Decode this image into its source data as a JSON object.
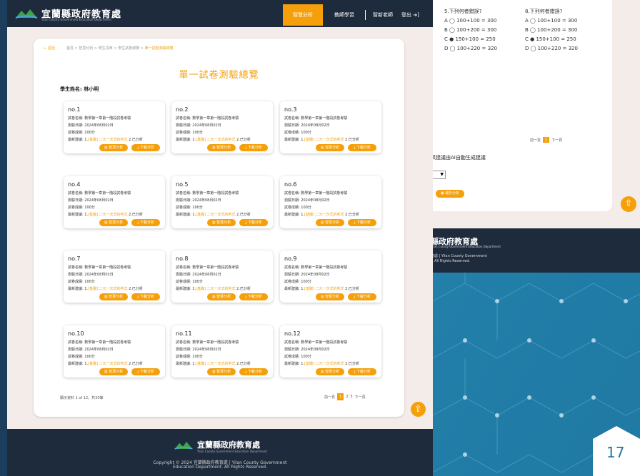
{
  "app": {
    "title": "宜蘭縣政府教育處",
    "subtitle": "Yilan County Government Education Department"
  },
  "nav": {
    "active": "智慧分析",
    "items": [
      "教師學習",
      "智新老師",
      "登出"
    ]
  },
  "breadcrumb": {
    "back": "← 返回",
    "path": "首頁 > 智慧分析 > 學生清單 > 學生試卷總覽 > ",
    "current": "單一試卷測驗總覽"
  },
  "page": {
    "title": "單一試卷測驗總覽",
    "student": "學生姓名: 林小明"
  },
  "card_labels": {
    "name": "試卷名稱: 數學第一章第一階段試卷考驗",
    "date": "測驗日期: 2024年08月02日",
    "score": "試卷成績: 100分",
    "suggest_prefix": "最新建議: 1.",
    "suggest_link": "[基礎] 二元一次式的判式",
    "suggest_suffix": " 2.已分析",
    "btn_analysis": "智慧分析",
    "btn_download": "下載分析"
  },
  "cards": [
    {
      "no": "no.1"
    },
    {
      "no": "no.2"
    },
    {
      "no": "no.3"
    },
    {
      "no": "no.4"
    },
    {
      "no": "no.5"
    },
    {
      "no": "no.6"
    },
    {
      "no": "no.7"
    },
    {
      "no": "no.8"
    },
    {
      "no": "no.9"
    },
    {
      "no": "no.10"
    },
    {
      "no": "no.11"
    },
    {
      "no": "no.12"
    }
  ],
  "count": "顯示資料 1 of 12，共30筆",
  "pager": {
    "prev": "前一頁",
    "pages": [
      "1",
      "2",
      "3"
    ],
    "next": "下一頁"
  },
  "footer": {
    "title": "宜蘭縣政府教育處",
    "sub": "Yilan County Government Education Department",
    "line1": "Copyright © 2024 宜蘭縣政府教育處 | Yilan County Government",
    "line2": "Education Department. All Rights Reserved."
  },
  "right_panel": {
    "q5": {
      "title": "5.下列何者錯誤?",
      "opts": [
        "A ◯ 100+100 = 300",
        "B ◯ 100+200 = 300",
        "C ● 150+100 = 250",
        "D ◯ 100+220 = 320"
      ]
    },
    "q8": {
      "title": "8.下列何者錯誤?",
      "opts": [
        "A ◯ 100+100 = 300",
        "B ◯ 100+200 = 300",
        "C ● 150+100 = 250",
        "D ◯ 100+220 = 320"
      ]
    },
    "pager": {
      "prev": "前一頁",
      "cur": "1",
      "next": "下一頁"
    },
    "ai_label": "供建議由AI自動生成建議",
    "save": "儲存分析",
    "footer_title": "縣政府教育處",
    "footer_sub": "Yilan County Government Education Department",
    "footer_c1": "育處 | Yilan County Government",
    "footer_c2": "t. All Rights Reserved."
  },
  "slide_number": "17",
  "colors": {
    "accent": "#f5a00a",
    "navy": "#1e2b3d",
    "bg": "#f3ece8",
    "slide": "#1f74a0"
  }
}
